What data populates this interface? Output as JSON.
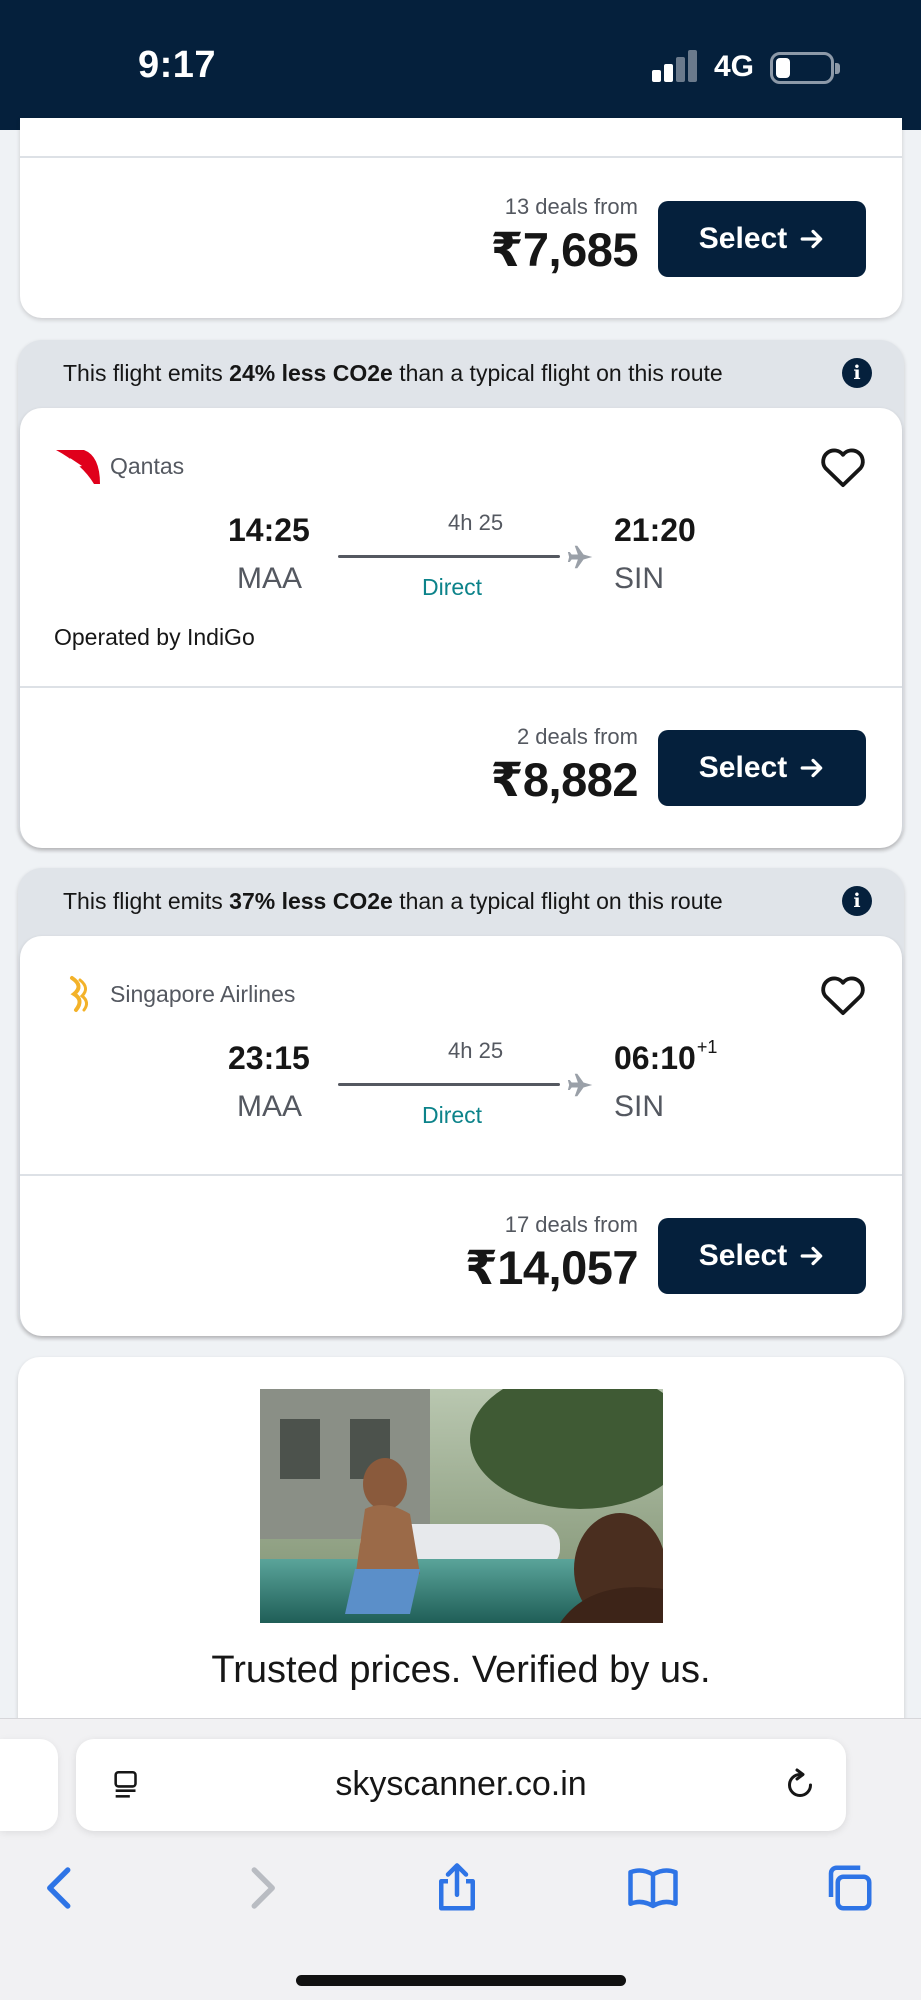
{
  "status_bar": {
    "time": "9:17",
    "network": "4G"
  },
  "flights": [
    {
      "deals": "13 deals from",
      "price": "₹7,685",
      "select_label": "Select"
    },
    {
      "eco": {
        "prefix": "This flight emits ",
        "highlight": "24% less CO2e",
        "suffix": " than a typical flight on this route"
      },
      "airline": "Qantas",
      "depart_time": "14:25",
      "depart_code": "MAA",
      "duration": "4h 25",
      "stops": "Direct",
      "arrive_time": "21:20",
      "arrive_code": "SIN",
      "operated": "Operated by IndiGo",
      "deals": "2 deals from",
      "price": "₹8,882",
      "select_label": "Select"
    },
    {
      "eco": {
        "prefix": "This flight emits ",
        "highlight": "37% less CO2e",
        "suffix": " than a typical flight on this route"
      },
      "airline": "Singapore Airlines",
      "depart_time": "23:15",
      "depart_code": "MAA",
      "duration": "4h 25",
      "stops": "Direct",
      "arrive_time": "06:10",
      "arrive_day_offset": "+1",
      "arrive_code": "SIN",
      "deals": "17 deals from",
      "price": "₹14,057",
      "select_label": "Select"
    }
  ],
  "promo": {
    "title": "Trusted prices. Verified by us."
  },
  "browser": {
    "url": "skyscanner.co.in"
  },
  "colors": {
    "brand_navy": "#05203c",
    "direct_teal": "#0c838a",
    "qantas_red": "#e0001b",
    "sia_gold": "#f3b229"
  }
}
